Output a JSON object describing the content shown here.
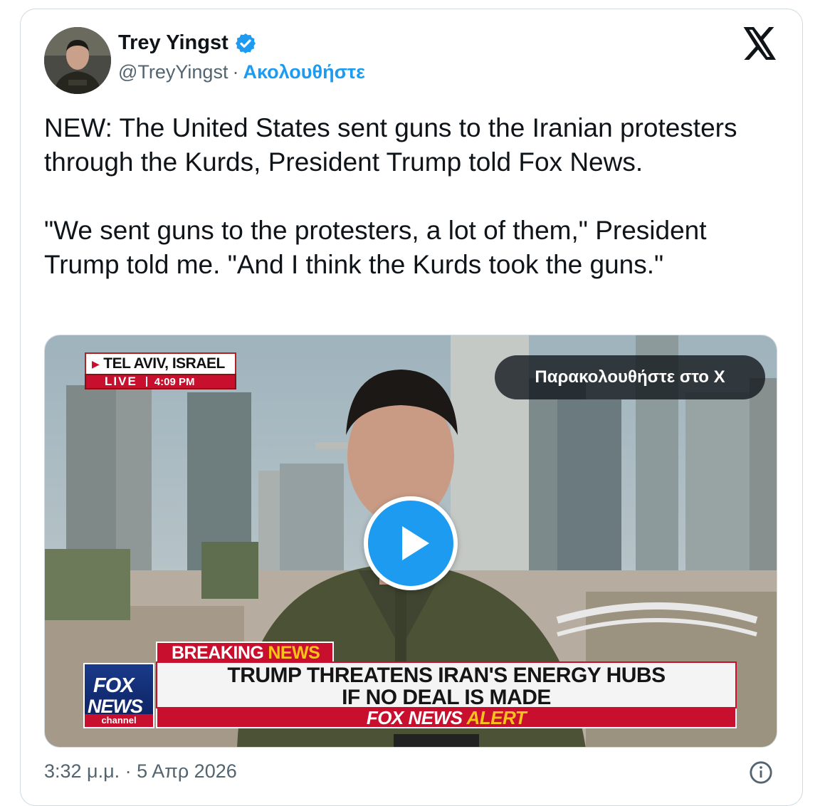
{
  "author": {
    "name": "Trey Yingst",
    "handle": "@TreyYingst",
    "separator": "·",
    "follow_label": "Ακολουθήστε",
    "verified": true
  },
  "tweet": {
    "paragraphs": [
      "NEW: The United States sent guns to the Iranian protesters through the Kurds, President Trump told Fox News.",
      "\"We sent guns to the protesters, a lot of them,\" President Trump told me. \"And I think the Kurds took the guns.\""
    ]
  },
  "media": {
    "watch_label": "Παρακολουθήστε στο X",
    "location": "TEL AVIV, ISRAEL",
    "live_label": "LIVE",
    "live_time": "4:09 PM",
    "breaking_label": "BREAKING",
    "breaking_news_word": "NEWS",
    "headline_line1": "TRUMP THREATENS IRAN'S ENERGY HUBS",
    "headline_line2": "IF NO DEAL IS MADE",
    "alert_label": "FOX NEWS",
    "alert_word": "ALERT",
    "logo_fox": "FOX",
    "logo_news": "NEWS",
    "logo_channel": "channel"
  },
  "footer": {
    "timestamp": "3:32 μ.μ. · 5 Απρ 2026"
  },
  "colors": {
    "accent": "#1d9bf0",
    "text": "#0f1419",
    "muted": "#536471",
    "fox_red": "#c8102e",
    "fox_blue": "#0b1f5c"
  },
  "icons": {
    "verified": "verified-badge-icon",
    "brand": "x-logo-icon",
    "play": "play-icon",
    "info": "info-icon"
  }
}
